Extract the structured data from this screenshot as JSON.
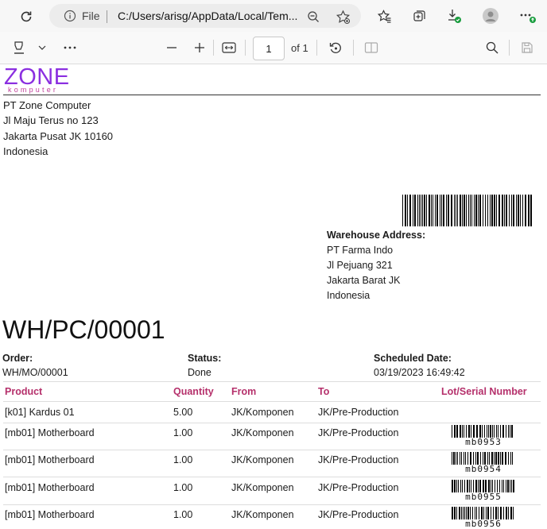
{
  "browser": {
    "address_prefix": "File",
    "url": "C:/Users/arisg/AppData/Local/Tem..."
  },
  "pdf_toolbar": {
    "page_number": "1",
    "page_total": "of 1"
  },
  "document": {
    "logo": {
      "main": "ZONE",
      "sub": "komputer"
    },
    "company_address": [
      "PT Zone Computer",
      "Jl Maju Terus no 123",
      "Jakarta Pusat JK 10160",
      "Indonesia"
    ],
    "warehouse": {
      "label": "Warehouse Address:",
      "lines": [
        "PT Farma Indo",
        "Jl Pejuang 321",
        "Jakarta Barat JK",
        "Indonesia"
      ]
    },
    "title": "WH/PC/00001",
    "info": [
      {
        "label": "Order:",
        "value": "WH/MO/00001"
      },
      {
        "label": "Status:",
        "value": "Done"
      },
      {
        "label": "Scheduled Date:",
        "value": "03/19/2023 16:49:42"
      }
    ],
    "table": {
      "headers": [
        "Product",
        "Quantity",
        "From",
        "To",
        "Lot/Serial Number"
      ],
      "rows": [
        {
          "product": "[k01] Kardus 01",
          "quantity": "5.00",
          "from": "JK/Komponen",
          "to": "JK/Pre-Production",
          "lot": ""
        },
        {
          "product": "[mb01] Motherboard",
          "quantity": "1.00",
          "from": "JK/Komponen",
          "to": "JK/Pre-Production",
          "lot": "mb0953"
        },
        {
          "product": "[mb01] Motherboard",
          "quantity": "1.00",
          "from": "JK/Komponen",
          "to": "JK/Pre-Production",
          "lot": "mb0954"
        },
        {
          "product": "[mb01] Motherboard",
          "quantity": "1.00",
          "from": "JK/Komponen",
          "to": "JK/Pre-Production",
          "lot": "mb0955"
        },
        {
          "product": "[mb01] Motherboard",
          "quantity": "1.00",
          "from": "JK/Komponen",
          "to": "JK/Pre-Production",
          "lot": "mb0956"
        }
      ]
    }
  }
}
